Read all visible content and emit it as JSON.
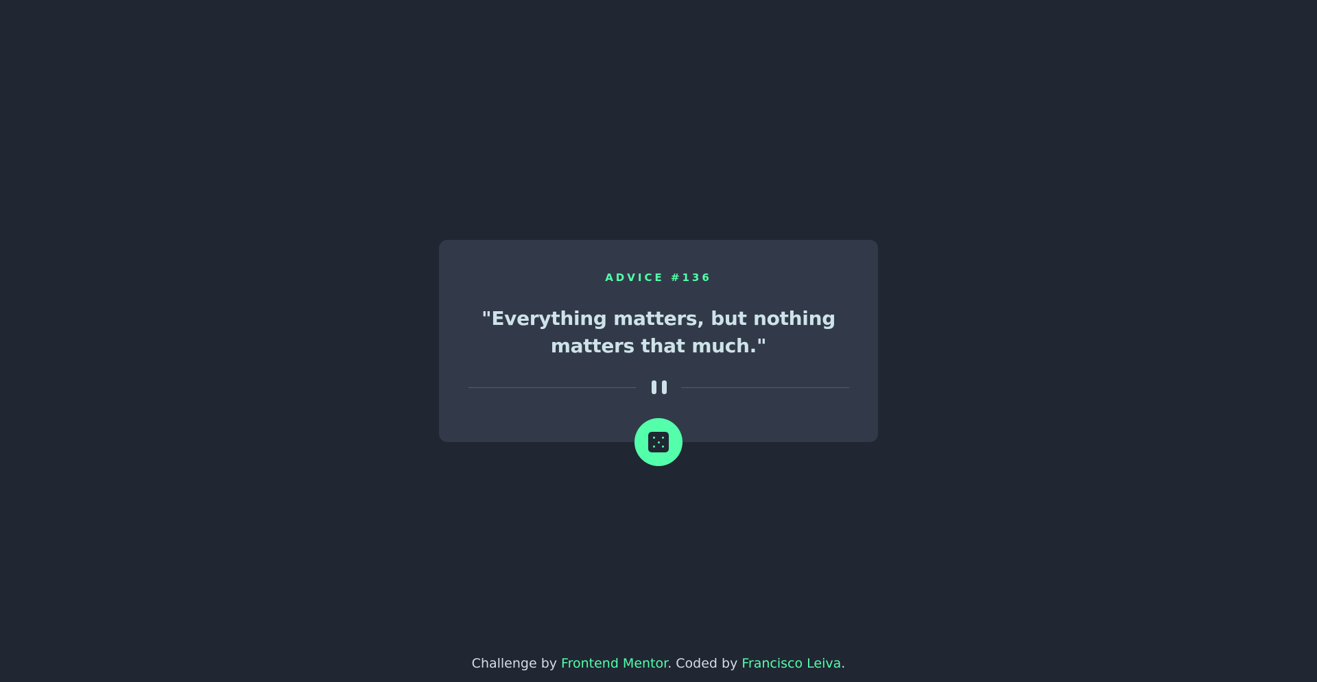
{
  "advice": {
    "label": "ADVICE #136",
    "quote": "\"Everything matters, but nothing matters that much.\""
  },
  "divider": {
    "icon": "pause-icon"
  },
  "dice_button": {
    "icon": "dice-icon"
  },
  "footer": {
    "prefix": "Challenge by ",
    "challenge_link": "Frontend Mentor",
    "middle": ". Coded by ",
    "author_link": "Francisco Leiva",
    "suffix": "."
  },
  "colors": {
    "background": "#202632",
    "card": "#323a49",
    "accent": "#53ffaa",
    "text": "#cee3e9",
    "divider": "#4f5d74"
  }
}
